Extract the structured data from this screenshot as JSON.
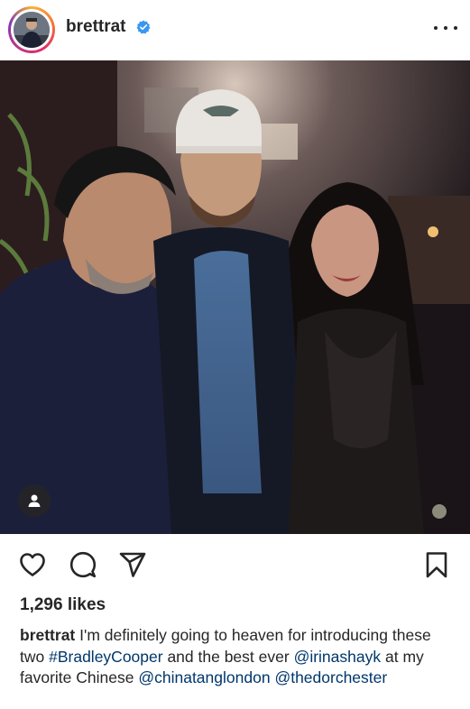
{
  "post": {
    "username": "brettrat",
    "verified_icon": "verified-badge-icon",
    "more_icon": "more-options-icon",
    "likes": "1,296 likes",
    "caption": {
      "username": "brettrat",
      "text_1": "I'm definitely going to heaven for introducing these two",
      "hashtag": "#BradleyCooper",
      "text_2": "and the best ever",
      "mention_1": "@irinashayk",
      "text_3": "at my favorite Chinese",
      "mention_2": "@chinatanglondon",
      "mention_3": "@thedorchester"
    }
  },
  "actions": {
    "like_icon": "heart-icon",
    "comment_icon": "comment-icon",
    "share_icon": "paper-plane-icon",
    "save_icon": "bookmark-icon"
  },
  "colors": {
    "text": "#262626",
    "link": "#00376b",
    "verified": "#3897f0"
  }
}
